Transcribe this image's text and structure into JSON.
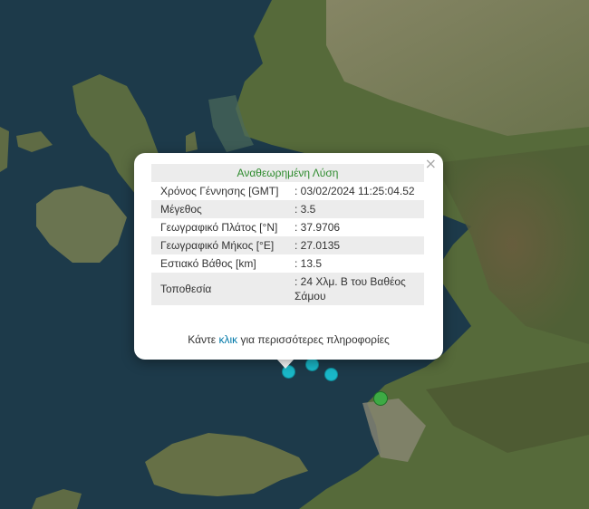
{
  "popup": {
    "title": "Αναθεωρημένη Λύση",
    "close_label": "×",
    "rows": [
      {
        "label": "Χρόνος Γέννησης [GMT]",
        "value": ": 03/02/2024 11:25:04.52"
      },
      {
        "label": "Μέγεθος",
        "value": ": 3.5"
      },
      {
        "label": "Γεωγραφικό Πλάτος [°N]",
        "value": ": 37.9706"
      },
      {
        "label": "Γεωγραφικό Μήκος [°E]",
        "value": ": 27.0135"
      },
      {
        "label": "Εστιακό Βάθος [km]",
        "value": ": 13.5"
      },
      {
        "label": "Τοποθεσία",
        "value": ": 24 Χλμ. Β του Βαθέος Σάμου"
      }
    ],
    "more_prefix": "Κάντε",
    "more_link": "κλικ",
    "more_suffix": "για περισσότερες πληροφορίες"
  },
  "colors": {
    "sea": "#1d3a4a",
    "land": "#5b6a3f",
    "title_green": "#2e8b2e",
    "link_blue": "#0078a8",
    "marker_cyan": "#1ab8c9",
    "marker_green": "#3daa44"
  },
  "markers": [
    {
      "name": "earthquake-marker-selected",
      "color": "cyan"
    },
    {
      "name": "earthquake-marker",
      "color": "cyan"
    },
    {
      "name": "earthquake-marker",
      "color": "cyan"
    },
    {
      "name": "earthquake-marker",
      "color": "green"
    }
  ]
}
